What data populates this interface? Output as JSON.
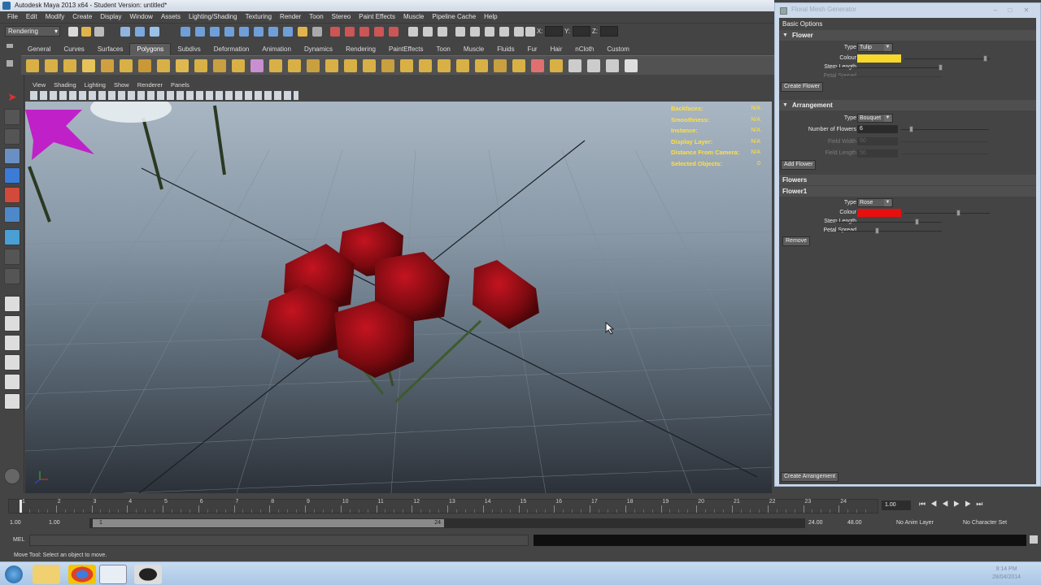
{
  "window": {
    "title": "Autodesk Maya 2013 x64 - Student Version: untitled*"
  },
  "menu": [
    "File",
    "Edit",
    "Modify",
    "Create",
    "Display",
    "Window",
    "Assets",
    "Lighting/Shading",
    "Texturing",
    "Render",
    "Toon",
    "Stereo",
    "Paint Effects",
    "Muscle",
    "Pipeline Cache",
    "Help"
  ],
  "status_line": {
    "mode": "Rendering",
    "x_label": "X:",
    "y_label": "Y:",
    "z_label": "Z:"
  },
  "shelf_tabs": [
    {
      "label": "General",
      "active": false
    },
    {
      "label": "Curves",
      "active": false
    },
    {
      "label": "Surfaces",
      "active": false
    },
    {
      "label": "Polygons",
      "active": true
    },
    {
      "label": "Subdivs",
      "active": false
    },
    {
      "label": "Deformation",
      "active": false
    },
    {
      "label": "Animation",
      "active": false
    },
    {
      "label": "Dynamics",
      "active": false
    },
    {
      "label": "Rendering",
      "active": false
    },
    {
      "label": "PaintEffects",
      "active": false
    },
    {
      "label": "Toon",
      "active": false
    },
    {
      "label": "Muscle",
      "active": false
    },
    {
      "label": "Fluids",
      "active": false
    },
    {
      "label": "Fur",
      "active": false
    },
    {
      "label": "Hair",
      "active": false
    },
    {
      "label": "nCloth",
      "active": false
    },
    {
      "label": "Custom",
      "active": false
    }
  ],
  "panel_menu": [
    "View",
    "Shading",
    "Lighting",
    "Show",
    "Renderer",
    "Panels"
  ],
  "hud": [
    {
      "label": "Backfaces:",
      "value": "N/A"
    },
    {
      "label": "Smoothness:",
      "value": "N/A"
    },
    {
      "label": "Instance:",
      "value": "N/A"
    },
    {
      "label": "Display Layer:",
      "value": "N/A"
    },
    {
      "label": "Distance From Camera:",
      "value": "N/A"
    },
    {
      "label": "Selected Objects:",
      "value": "0"
    }
  ],
  "timeline": {
    "ticks": [
      "1",
      "2",
      "3",
      "4",
      "5",
      "6",
      "7",
      "8",
      "9",
      "10",
      "11",
      "12",
      "13",
      "14",
      "15",
      "16",
      "17",
      "18",
      "19",
      "20",
      "21",
      "22",
      "23",
      "24"
    ],
    "current_frame": "1.00"
  },
  "range": {
    "start": "1.00",
    "playback_start": "1.00",
    "slider_start": "1",
    "slider_end": "24",
    "playback_end": "24.00",
    "end": "48.00",
    "anim_layer": "No Anim Layer",
    "character_set": "No Character Set"
  },
  "command_line": {
    "label": "MEL"
  },
  "help_line": "Move Tool: Select an object to move.",
  "floral": {
    "title": "Floral Mesh Generator",
    "basic_options": "Basic Options",
    "flower_section": "Flower",
    "type_label": "Type",
    "flower_type": "Tulip",
    "colour_label": "Colour",
    "flower_colour": "#f6d92c",
    "stem_length_label": "Stem Length",
    "petal_spread_label": "Petal Spread",
    "create_flower": "Create Flower",
    "arrangement_section": "Arrangement",
    "arrangement_type": "Bouquet",
    "num_flowers_label": "Number of Flowers",
    "num_flowers": "6",
    "field_width_label": "Field Width",
    "field_width": "50",
    "field_length_label": "Field Length",
    "field_length": "50",
    "add_flower": "Add Flower",
    "flowers_section": "Flowers",
    "flower1_section": "Flower1",
    "flower1_type": "Rose",
    "flower1_colour": "#e80f0f",
    "remove": "Remove",
    "create_arrangement": "Create Arrangement"
  },
  "taskbar": {
    "clock_time": "9:14 PM",
    "clock_date": "28/04/2014"
  }
}
